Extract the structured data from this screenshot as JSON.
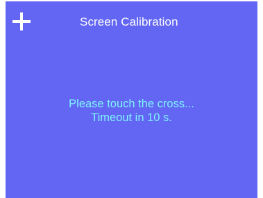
{
  "window": {
    "title": "Screen Calibration"
  },
  "calibration": {
    "target_icon": "cross-icon",
    "prompt": "Please touch the cross...",
    "timeout_text": "Timeout in 10 s."
  },
  "colors": {
    "background": "#6266f2",
    "title": "#ffffff",
    "message": "#7ff3ff",
    "cross": "#ffffff"
  }
}
